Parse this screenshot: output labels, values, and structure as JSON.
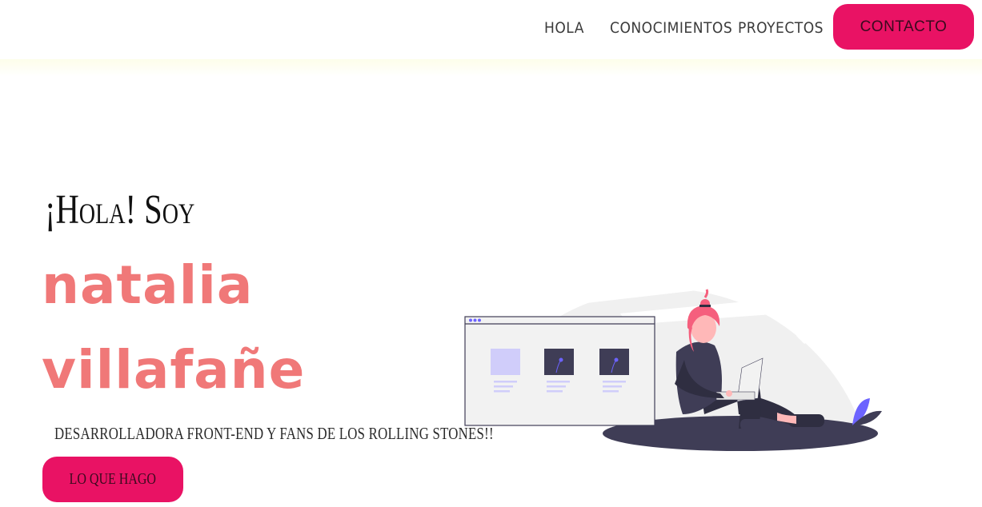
{
  "nav": {
    "links": [
      "HOLA",
      "CONOCIMIENTOS",
      "PROYECTOS"
    ],
    "contact_label": "CONTACTO"
  },
  "hero": {
    "greeting": "¡Hola! Soy",
    "name_first": "natalia",
    "name_last": "villafañe",
    "subtitle": "DESARROLLADORA FRONT-END Y FANS DE LOS ROLLING STONES!!",
    "cta_label": "LO QUE HAGO"
  },
  "colors": {
    "accent": "#e91264",
    "name": "#f07878",
    "illustration_purple": "#6c63ff",
    "illustration_dark": "#3f3d56",
    "hair": "#f55f7d"
  }
}
